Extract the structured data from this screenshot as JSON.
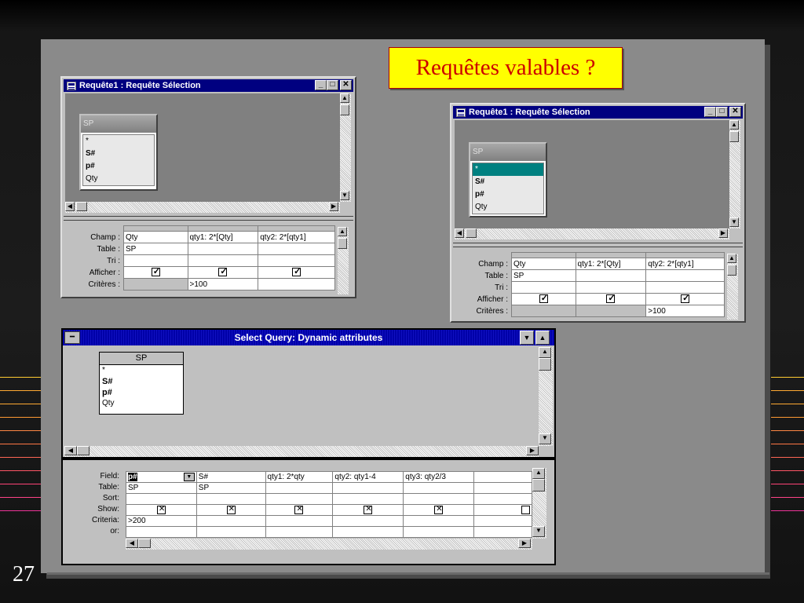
{
  "slide": {
    "title": "Requêtes valables ?",
    "page_number": "27"
  },
  "colors": {
    "slide_bg": "#8a8a8a",
    "title_bg": "#ffff00",
    "title_text": "#cc0000",
    "titlebar": "#000080"
  },
  "win1": {
    "title": "Requête1 : Requête Sélection",
    "btn_min": "_",
    "btn_max": "□",
    "btn_close": "✕",
    "table_name": "SP",
    "fields": [
      "*",
      "S#",
      "p#",
      "Qty"
    ],
    "row_labels": [
      "Champ :",
      "Table :",
      "Tri :",
      "Afficher :",
      "Critères :"
    ],
    "columns": [
      {
        "field": "Qty",
        "table": "SP",
        "sort": "",
        "criteria": ""
      },
      {
        "field": "qty1: 2*[Qty]",
        "table": "",
        "sort": "",
        "criteria": ">100"
      },
      {
        "field": "qty2: 2*[qty1]",
        "table": "",
        "sort": "",
        "criteria": ""
      }
    ]
  },
  "win2": {
    "title": "Requête1 : Requête Sélection",
    "btn_min": "_",
    "btn_max": "□",
    "btn_close": "✕",
    "table_name": "SP",
    "fields": [
      "*",
      "S#",
      "p#",
      "Qty"
    ],
    "row_labels": [
      "Champ :",
      "Table :",
      "Tri :",
      "Afficher :",
      "Critères :"
    ],
    "columns": [
      {
        "field": "Qty",
        "table": "SP",
        "sort": "",
        "criteria": ""
      },
      {
        "field": "qty1: 2*[Qty]",
        "table": "",
        "sort": "",
        "criteria": ""
      },
      {
        "field": "qty2: 2*[qty1]",
        "table": "",
        "sort": "",
        "criteria": ">100"
      }
    ]
  },
  "win3": {
    "title": "Select Query: Dynamic attributes",
    "sys_glyph": "━",
    "btn_down": "▼",
    "btn_up": "▲",
    "table_name": "SP",
    "fields": [
      "*",
      "S#",
      "p#",
      "Qty"
    ],
    "row_labels": [
      "Field:",
      "Table:",
      "Sort:",
      "Show:",
      "Criteria:",
      "or:"
    ],
    "columns": [
      {
        "field": "p#",
        "table": "SP",
        "criteria": ">200"
      },
      {
        "field": "S#",
        "table": "SP",
        "criteria": ""
      },
      {
        "field": "qty1: 2*qty",
        "table": "",
        "criteria": ""
      },
      {
        "field": "qty2: qty1-4",
        "table": "",
        "criteria": ""
      },
      {
        "field": "qty3: qty2/3",
        "table": "",
        "criteria": ""
      },
      {
        "field": "",
        "table": "",
        "criteria": ""
      }
    ]
  }
}
